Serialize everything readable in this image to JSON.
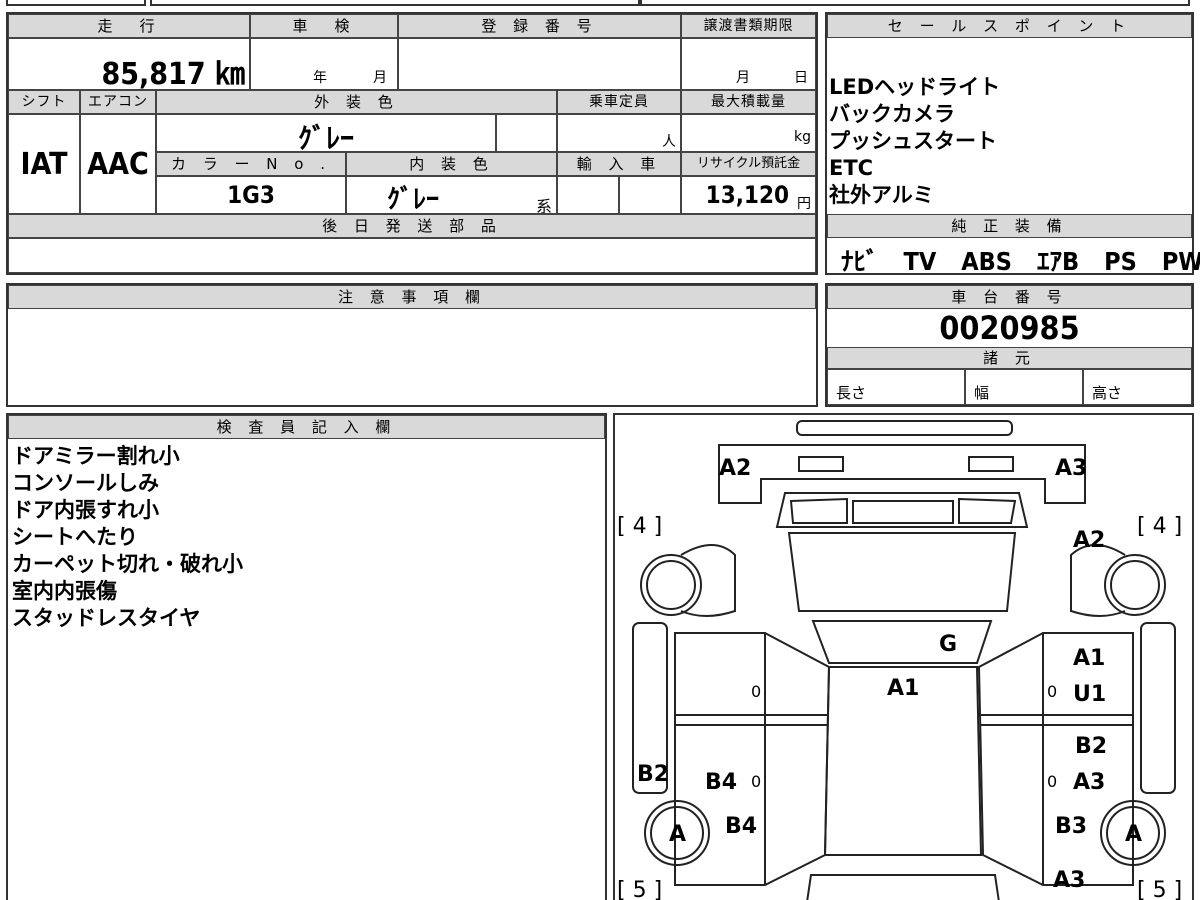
{
  "headers": {
    "mileage": "走　行",
    "shaken": "車　検",
    "registration": "登 録 番 号",
    "transfer_deadline": "譲渡書類期限",
    "sales_point": "セ ー ル ス ポ イ ン ト",
    "shift": "シフト",
    "aircon": "エアコン",
    "exterior_color": "外 装 色",
    "capacity": "乗車定員",
    "max_load": "最大積載量",
    "color_no": "カ ラ ー N o .",
    "interior_color": "内 装 色",
    "import": "輸 入 車",
    "recycle": "リサイクル預託金",
    "later_parts": "後 日 発 送 部 品",
    "genuine_equipment": "純 正 装 備",
    "notes": "注 意 事 項 欄",
    "chassis_no": "車 台 番 号",
    "specs": "諸 元",
    "inspector": "検 査 員 記 入 欄"
  },
  "values": {
    "mileage": "85,817 ㎞",
    "shaken_year": "年",
    "shaken_month": "月",
    "deadline_month": "月",
    "deadline_day": "日",
    "shift": "IAT",
    "aircon": "AAC",
    "exterior_color": "ｸﾞﾚｰ",
    "capacity_unit": "人",
    "max_load_unit": "kg",
    "color_no": "1G3",
    "interior_color": "ｸﾞﾚｰ",
    "interior_suffix": "系",
    "recycle": "13,120",
    "recycle_unit": "円",
    "genuine_equipment": "ﾅﾋﾞ　TV　ABS　ｴｱB　PS　PW",
    "chassis_no": "0020985",
    "length": "長さ",
    "width": "幅",
    "height": "高さ"
  },
  "sales_points": [
    "LEDヘッドライト",
    "バックカメラ",
    "プッシュスタート",
    "ETC",
    "社外アルミ"
  ],
  "inspector_notes": [
    "ドアミラー割れ小",
    "コンソールしみ",
    "ドア内張すれ小",
    "シートへたり",
    "カーペット切れ・破れ小",
    "室内内張傷",
    "スタッドレスタイヤ"
  ],
  "diagram": {
    "a2_left": "A2",
    "a3_top_right": "A3",
    "a2_right": "A2",
    "bracket_4_left": "[ 4 ]",
    "bracket_4_right": "[ 4 ]",
    "bracket_5_left": "[ 5 ]",
    "bracket_5_right": "[ 5 ]",
    "g": "G",
    "a1_center": "A1",
    "a1_right": "A1",
    "u1_right": "U1",
    "b2_right": "B2",
    "a3_right": "A3",
    "b2_left": "B2",
    "b4_left_a": "B4",
    "b4_left_b": "B4",
    "b3_right": "B3",
    "a3_bottom_right": "A3",
    "tire_left": "A",
    "tire_right": "A",
    "zero_left_1": "0",
    "zero_right_1": "0",
    "zero_left_2": "0",
    "zero_right_2": "0"
  }
}
